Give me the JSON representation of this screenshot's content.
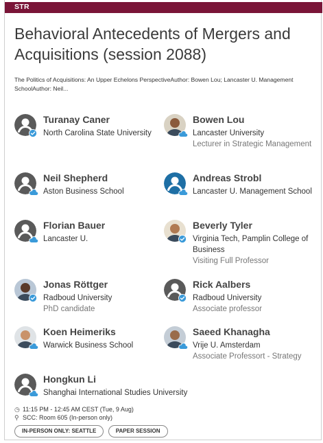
{
  "header": {
    "track": "STR"
  },
  "session": {
    "title": "Behavioral Antecedents of Mergers and Acquisitions (session 2088)",
    "abstract": "The Politics of Acquisitions: An Upper Echelons PerspectiveAuthor: Bowen Lou; Lancaster U. Management SchoolAuthor: Neil..."
  },
  "people": [
    {
      "name": "Turanay Caner",
      "affiliation": "North Carolina State University",
      "role": "",
      "avatar": "generic",
      "badge": "verified-check-icon"
    },
    {
      "name": "Bowen Lou",
      "affiliation": "Lancaster University",
      "role": "Lecturer in Strategic Management",
      "avatar": "photo",
      "badge": "cloud-icon"
    },
    {
      "name": "Neil Shepherd",
      "affiliation": "Aston Business School",
      "role": "",
      "avatar": "generic",
      "badge": "cloud-icon"
    },
    {
      "name": "Andreas Strobl",
      "affiliation": "Lancaster U. Management School",
      "role": "",
      "avatar": "generic-blue",
      "badge": "cloud-icon"
    },
    {
      "name": "Florian Bauer",
      "affiliation": "Lancaster U.",
      "role": "",
      "avatar": "generic",
      "badge": "cloud-icon"
    },
    {
      "name": "Beverly Tyler",
      "affiliation": "Virginia Tech, Pamplin College of Business",
      "role": "Visiting Full Professor",
      "avatar": "photo",
      "badge": "verified-check-icon"
    },
    {
      "name": "Jonas Röttger",
      "affiliation": "Radboud University",
      "role": "PhD candidate",
      "avatar": "photo",
      "badge": "verified-check-icon"
    },
    {
      "name": "Rick Aalbers",
      "affiliation": "Radboud University",
      "role": "Associate professor",
      "avatar": "generic",
      "badge": "verified-check-icon"
    },
    {
      "name": "Koen Heimeriks",
      "affiliation": "Warwick Business School",
      "role": "",
      "avatar": "photo",
      "badge": "cloud-icon"
    },
    {
      "name": "Saeed Khanagha",
      "affiliation": "Vrije U. Amsterdam",
      "role": "Associate Professort - Strategy",
      "avatar": "photo",
      "badge": "cloud-icon"
    },
    {
      "name": "Hongkun Li",
      "affiliation": "Shanghai International Studies University",
      "role": "",
      "avatar": "generic",
      "badge": "cloud-icon"
    }
  ],
  "meta": {
    "time": "11:15 PM - 12:45 AM CEST (Tue, 9 Aug)",
    "location": "SCC: Room 605 (In-person only)",
    "time_icon": "clock-icon",
    "location_icon": "location-pin-icon"
  },
  "tags": [
    "IN-PERSON ONLY: SEATTLE",
    "PAPER SESSION"
  ],
  "colors": {
    "brand": "#7a1538",
    "badge": "#3a9ad9",
    "generic_avatar": "#5a5a5a",
    "generic_avatar_blue": "#1e6fa5"
  }
}
